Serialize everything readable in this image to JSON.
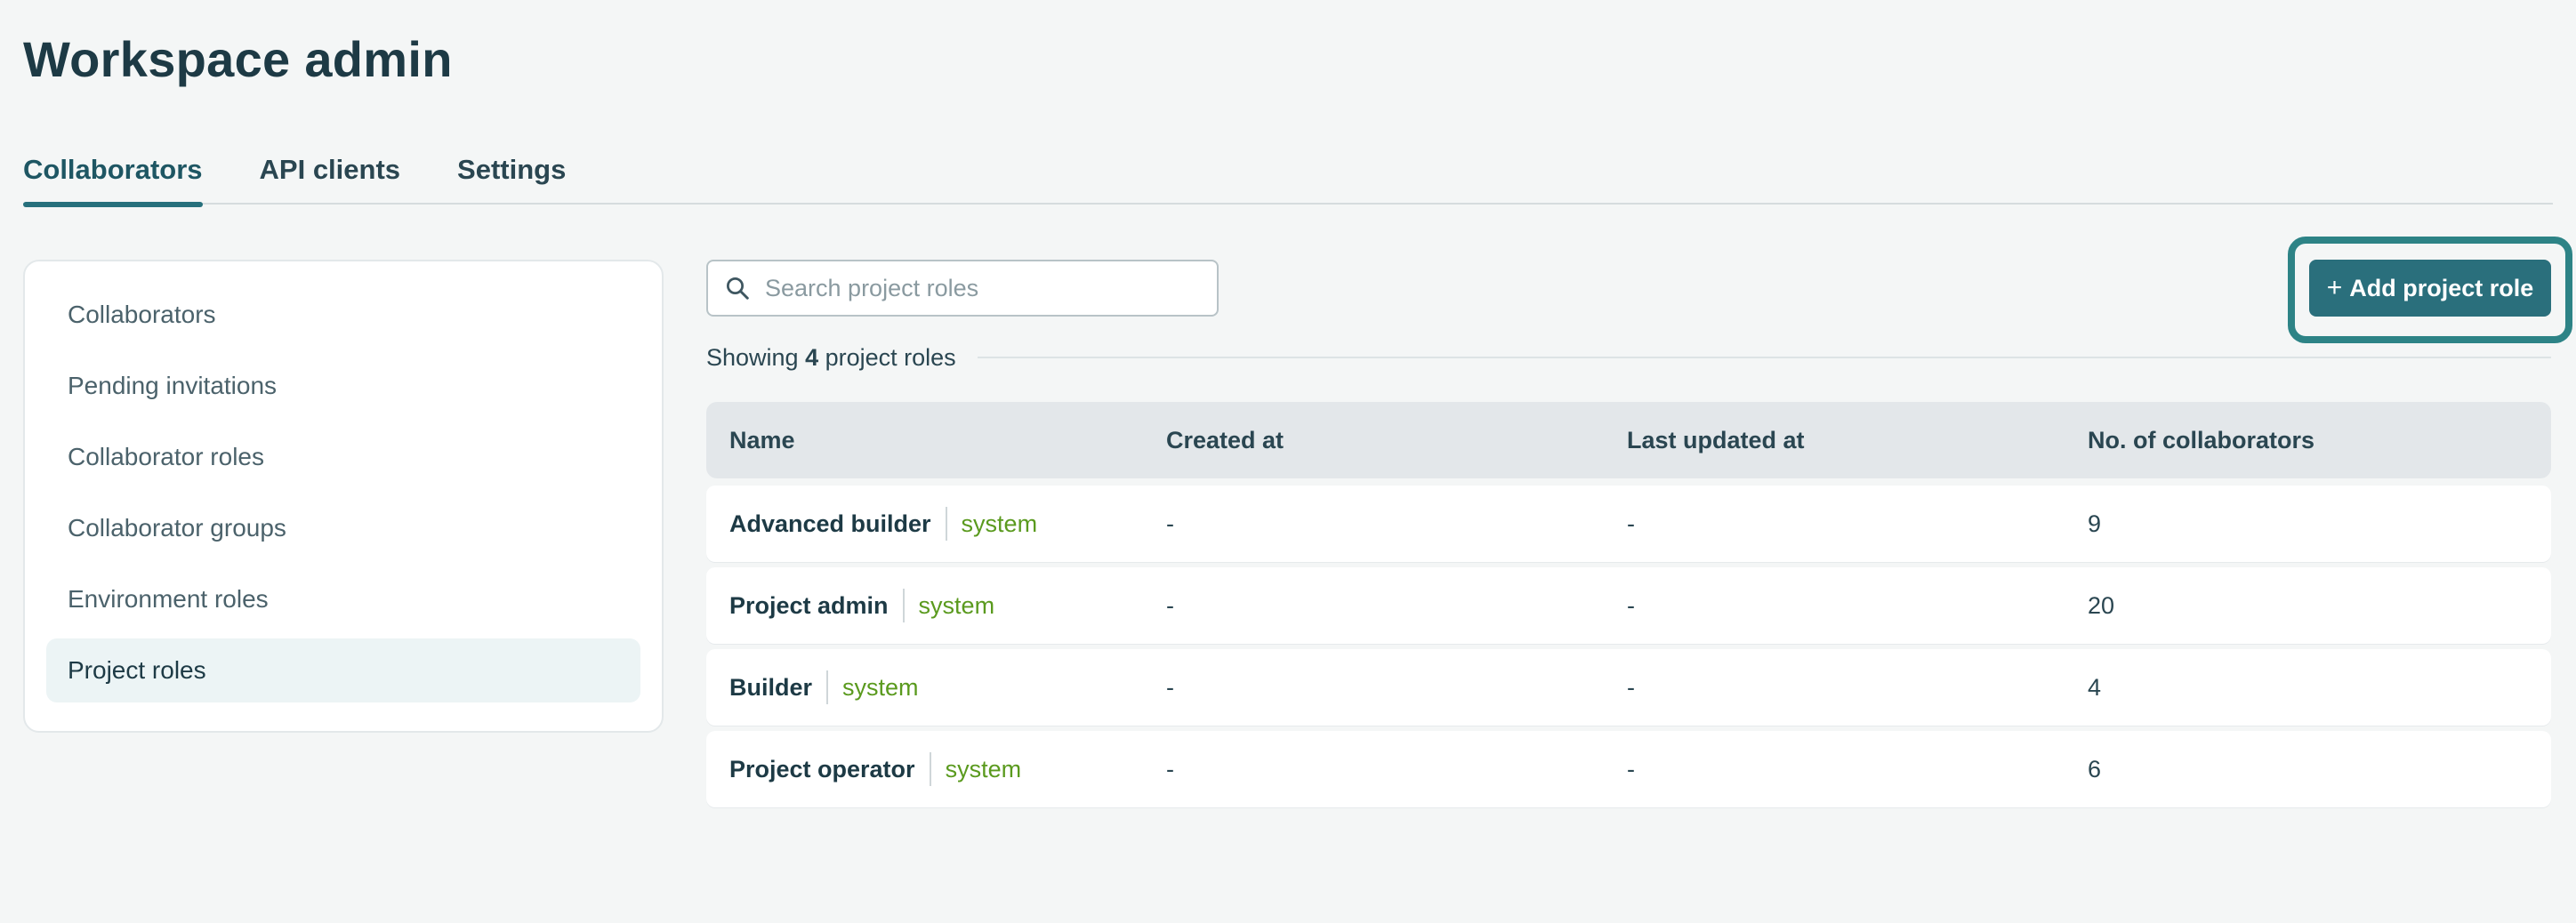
{
  "page_title": "Workspace admin",
  "tabs": [
    {
      "label": "Collaborators",
      "active": true
    },
    {
      "label": "API clients",
      "active": false
    },
    {
      "label": "Settings",
      "active": false
    }
  ],
  "sidebar": {
    "items": [
      {
        "label": "Collaborators"
      },
      {
        "label": "Pending invitations"
      },
      {
        "label": "Collaborator roles"
      },
      {
        "label": "Collaborator groups"
      },
      {
        "label": "Environment roles"
      },
      {
        "label": "Project roles",
        "active": true
      }
    ]
  },
  "search": {
    "placeholder": "Search project roles",
    "value": ""
  },
  "add_button": {
    "label": "Add project role",
    "icon": "plus-icon"
  },
  "summary": {
    "prefix": "Showing ",
    "count": "4",
    "suffix": " project roles"
  },
  "table": {
    "headers": [
      "Name",
      "Created at",
      "Last updated at",
      "No. of collaborators"
    ],
    "rows": [
      {
        "name": "Advanced builder",
        "badge": "system",
        "created": "-",
        "updated": "-",
        "collaborators": "9"
      },
      {
        "name": "Project admin",
        "badge": "system",
        "created": "-",
        "updated": "-",
        "collaborators": "20"
      },
      {
        "name": "Builder",
        "badge": "system",
        "created": "-",
        "updated": "-",
        "collaborators": "4"
      },
      {
        "name": "Project operator",
        "badge": "system",
        "created": "-",
        "updated": "-",
        "collaborators": "6"
      }
    ]
  },
  "colors": {
    "accent": "#2a6f7c",
    "highlight_frame": "#2d8386",
    "badge_green": "#5a9a1e",
    "background": "#f4f6f6"
  }
}
